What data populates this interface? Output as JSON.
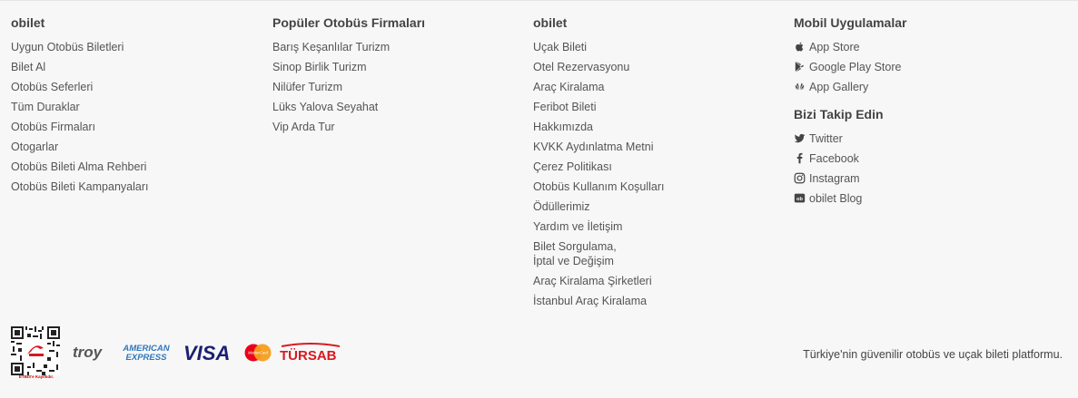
{
  "columns": [
    {
      "title": "obilet",
      "links": [
        "Uygun Otobüs Biletleri",
        "Bilet Al",
        "Otobüs Seferleri",
        "Tüm Duraklar",
        "Otobüs Firmaları",
        "Otogarlar",
        "Otobüs Bileti Alma Rehberi",
        "Otobüs Bileti Kampanyaları"
      ]
    },
    {
      "title": "Popüler Otobüs Firmaları",
      "links": [
        "Barış Keşanlılar Turizm",
        "Sinop Birlik Turizm",
        "Nilüfer Turizm",
        "Lüks Yalova Seyahat",
        "Vip Arda Tur"
      ]
    },
    {
      "title": "obilet",
      "links": [
        "Uçak Bileti",
        "Otel Rezervasyonu",
        "Araç Kiralama",
        "Feribot Bileti",
        "Hakkımızda",
        "KVKK Aydınlatma Metni",
        "Çerez Politikası",
        "Otobüs Kullanım Koşulları",
        "Ödüllerimiz",
        "Yardım ve İletişim",
        "Bilet Sorgulama,",
        "İptal ve Değişim",
        "Araç Kiralama Şirketleri",
        "İstanbul Araç Kiralama"
      ]
    }
  ],
  "mobile": {
    "title": "Mobil Uygulamalar",
    "links": [
      {
        "label": "App Store",
        "icon": "apple-icon"
      },
      {
        "label": "Google Play Store",
        "icon": "google-play-icon"
      },
      {
        "label": "App Gallery",
        "icon": "huawei-icon"
      }
    ]
  },
  "social": {
    "title": "Bizi Takip Edin",
    "links": [
      {
        "label": "Twitter",
        "icon": "twitter-icon"
      },
      {
        "label": "Facebook",
        "icon": "facebook-icon"
      },
      {
        "label": "Instagram",
        "icon": "instagram-icon"
      },
      {
        "label": "obilet Blog",
        "icon": "blog-icon"
      }
    ]
  },
  "bottom": {
    "qr_caption": "ETBİS'e Kayıtlıdır.",
    "logos": {
      "troy": "troy",
      "amex_line1": "AMERICAN",
      "amex_line2": "EXPRESS",
      "visa": "VISA",
      "mastercard": "MasterCard",
      "tursab": "TÜRSAB"
    },
    "tagline": "Türkiye'nin güvenilir otobüs ve uçak bileti platformu."
  },
  "colors": {
    "background": "#f7f7f7",
    "visa": "#1a1f71",
    "amex": "#2e77bc",
    "mastercard_red": "#eb001b",
    "mastercard_orange": "#f79e1b",
    "tursab": "#d71920"
  }
}
